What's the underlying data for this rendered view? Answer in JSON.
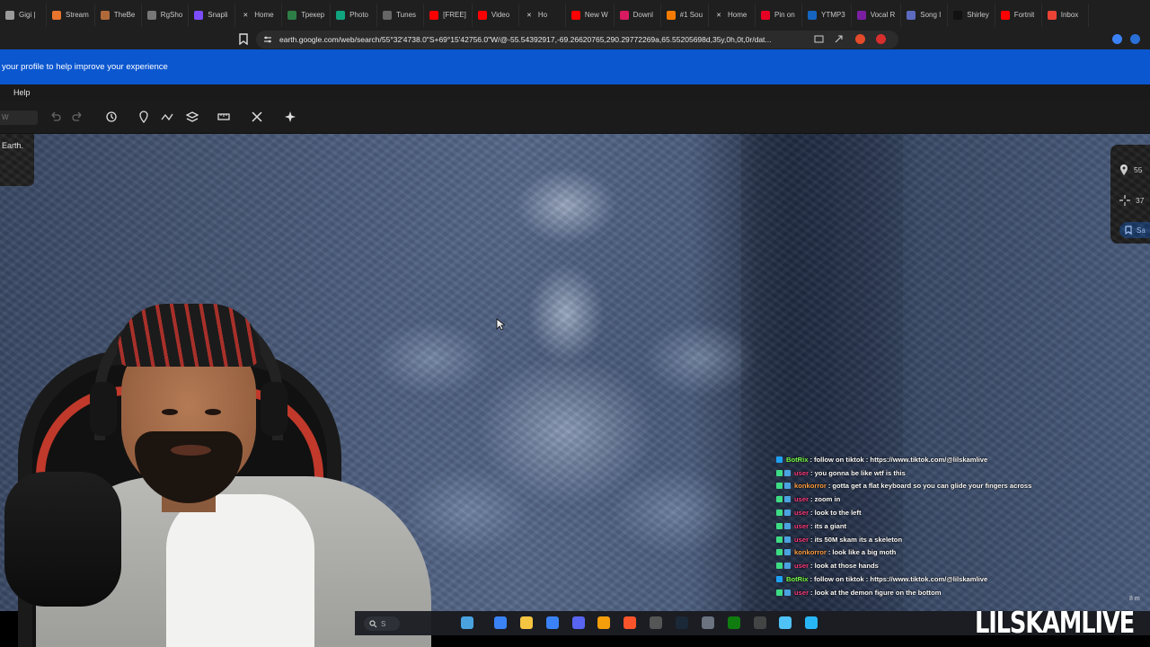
{
  "browser": {
    "tabs": [
      {
        "label": "Gigi |",
        "color": "#9b9b9b",
        "icon": "generic-tab-icon"
      },
      {
        "label": "Stream",
        "color": "#e8742e",
        "icon": "stream-icon"
      },
      {
        "label": "TheBe",
        "color": "#b06a3a",
        "icon": "store-icon"
      },
      {
        "label": "RgSho",
        "color": "#777777",
        "icon": "shop-icon"
      },
      {
        "label": "Snapli",
        "color": "#7c4dff",
        "icon": "snap-icon"
      },
      {
        "label": "Home",
        "color": "#000000",
        "icon": "x-icon"
      },
      {
        "label": "Трекер",
        "color": "#2d7d46",
        "icon": "tracker-icon"
      },
      {
        "label": "Photo",
        "color": "#10a37f",
        "icon": "chatgpt-icon"
      },
      {
        "label": "Tunes",
        "color": "#666666",
        "icon": "tunes-icon"
      },
      {
        "label": "[FREE]",
        "color": "#ff0000",
        "icon": "youtube-icon"
      },
      {
        "label": "Video",
        "color": "#ff0000",
        "icon": "youtube-icon"
      },
      {
        "label": "Ho",
        "color": "#000000",
        "icon": "x-icon"
      },
      {
        "label": "New W",
        "color": "#ff0000",
        "icon": "youtube-icon"
      },
      {
        "label": "Downl",
        "color": "#d81b60",
        "icon": "download-icon"
      },
      {
        "label": "#1 Sou",
        "color": "#f57c00",
        "icon": "sound-icon"
      },
      {
        "label": "Home",
        "color": "#000000",
        "icon": "x-icon"
      },
      {
        "label": "Pin on",
        "color": "#e60023",
        "icon": "pinterest-icon"
      },
      {
        "label": "YTMP3",
        "color": "#1565c0",
        "icon": "ytmp3-icon"
      },
      {
        "label": "Vocal R",
        "color": "#7b1fa2",
        "icon": "vocal-icon"
      },
      {
        "label": "Song I",
        "color": "#5c6bc0",
        "icon": "song-icon"
      },
      {
        "label": "Shirley",
        "color": "#111111",
        "icon": "s-icon"
      },
      {
        "label": "Fortnit",
        "color": "#ff0000",
        "icon": "youtube-icon"
      },
      {
        "label": "Inbox",
        "color": "#ea4335",
        "icon": "gmail-icon"
      }
    ],
    "url": "earth.google.com/web/search/55°32'4738.0\"S+69°15'42756.0\"W/@-55.54392917,-69.26620765,290.29772269a,65.55205698d,35y,0h,0t,0r/dat..."
  },
  "banner": {
    "text": "your profile to help improve your experience"
  },
  "menu": {
    "help": "Help"
  },
  "toolbar": {
    "search_stub": "W"
  },
  "earth": {
    "popup_text": "Earth.",
    "coords": {
      "lat": "55",
      "alt": "37"
    },
    "save_label": "Sa"
  },
  "chat": [
    {
      "user": "BotRix",
      "user_color": "#7cff4d",
      "message": "follow on tiktok : https://www.tiktok.com/@lilskamlive",
      "bot": true
    },
    {
      "user": "user",
      "user_color": "#ff3d7f",
      "message": "you gonna be like wtf is this",
      "bot": false
    },
    {
      "user": "konkorror",
      "user_color": "#ff9f43",
      "message": "gotta get a flat keyboard so you can glide your fingers across",
      "bot": false
    },
    {
      "user": "user",
      "user_color": "#ff3d7f",
      "message": "zoom in",
      "bot": false
    },
    {
      "user": "user",
      "user_color": "#ff3d7f",
      "message": "look to the left",
      "bot": false
    },
    {
      "user": "user",
      "user_color": "#ff3d7f",
      "message": "its a giant",
      "bot": false
    },
    {
      "user": "user",
      "user_color": "#ff3d7f",
      "message": "its 50M skam its a skeleton",
      "bot": false
    },
    {
      "user": "konkorror",
      "user_color": "#ff9f43",
      "message": "look like a big moth",
      "bot": false
    },
    {
      "user": "user",
      "user_color": "#ff3d7f",
      "message": "look at those hands",
      "bot": false
    },
    {
      "user": "BotRix",
      "user_color": "#7cff4d",
      "message": "follow on tiktok : https://www.tiktok.com/@lilskamlive",
      "bot": true
    },
    {
      "user": "user",
      "user_color": "#ff3d7f",
      "message": "look at the demon figure on the bottom",
      "bot": false
    }
  ],
  "taskbar": {
    "search_label": "S",
    "time": "8 m",
    "apps": [
      {
        "icon": "file-explorer-icon",
        "color": "#4aa3df"
      },
      {
        "icon": "copilot-icon",
        "color": "#3b82f6"
      },
      {
        "icon": "folder-icon",
        "color": "#f5c542"
      },
      {
        "icon": "store-icon",
        "color": "#3b82f6"
      },
      {
        "icon": "discord-icon",
        "color": "#5865f2"
      },
      {
        "icon": "chrome-orange-icon",
        "color": "#f59e0b"
      },
      {
        "icon": "brave-icon",
        "color": "#fb542b"
      },
      {
        "icon": "obs-icon",
        "color": "#555555"
      },
      {
        "icon": "steam-icon",
        "color": "#1b2838"
      },
      {
        "icon": "keyboard-icon",
        "color": "#6b7280"
      },
      {
        "icon": "xbox-icon",
        "color": "#107c10"
      },
      {
        "icon": "4k-icon",
        "color": "#444444"
      },
      {
        "icon": "notepad-icon",
        "color": "#4fc3f7"
      },
      {
        "icon": "photos-icon",
        "color": "#29b6f6"
      }
    ]
  },
  "watermark": "LILSKAMLIVE"
}
